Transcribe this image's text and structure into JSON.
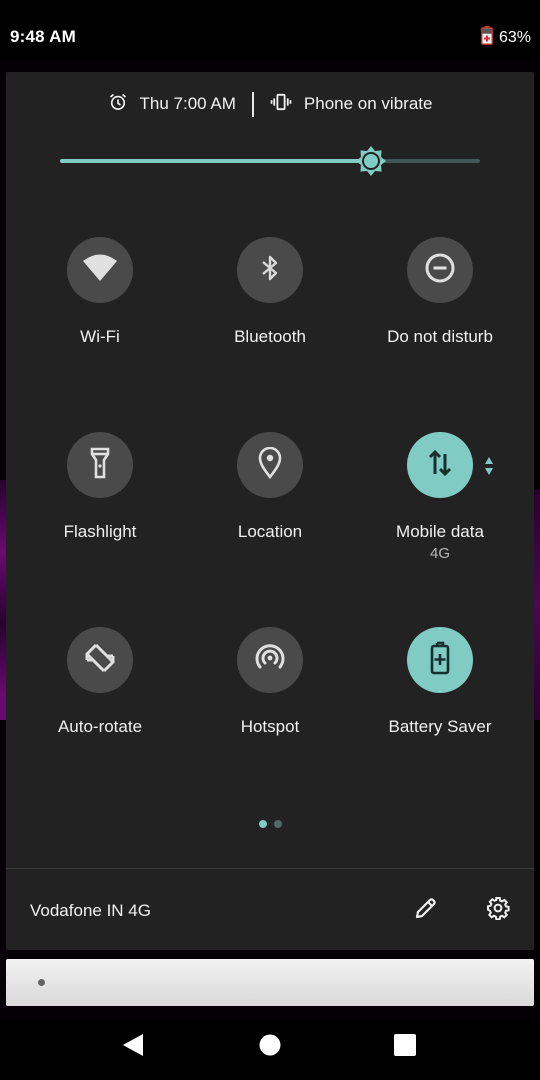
{
  "status_bar": {
    "time": "9:48 AM",
    "battery_icon": "battery-saver-charging-icon",
    "battery_percent": "63%"
  },
  "quick_settings": {
    "alarm": {
      "icon": "alarm-clock-icon",
      "text": "Thu 7:00 AM"
    },
    "ringer": {
      "icon": "vibrate-icon",
      "text": "Phone on vibrate"
    },
    "brightness": {
      "icon": "brightness-sun-icon",
      "level_fraction": 0.74
    },
    "tiles": [
      {
        "id": "wifi",
        "label": "Wi-Fi",
        "icon": "wifi-icon",
        "active": false
      },
      {
        "id": "bluetooth",
        "label": "Bluetooth",
        "icon": "bluetooth-icon",
        "active": false
      },
      {
        "id": "dnd",
        "label": "Do not disturb",
        "icon": "do-not-disturb-icon",
        "active": false
      },
      {
        "id": "flashlight",
        "label": "Flashlight",
        "icon": "flashlight-icon",
        "active": false
      },
      {
        "id": "location",
        "label": "Location",
        "icon": "location-pin-icon",
        "active": false
      },
      {
        "id": "mobile-data",
        "label": "Mobile data",
        "sublabel": "4G",
        "icon": "mobile-data-arrows-icon",
        "active": true,
        "expandable": true
      },
      {
        "id": "auto-rotate",
        "label": "Auto-rotate",
        "icon": "auto-rotate-icon",
        "active": false
      },
      {
        "id": "hotspot",
        "label": "Hotspot",
        "icon": "hotspot-icon",
        "active": false
      },
      {
        "id": "battery-saver",
        "label": "Battery Saver",
        "icon": "battery-saver-icon",
        "active": true
      }
    ],
    "pagination": {
      "pages": 2,
      "current": 1
    },
    "footer": {
      "carrier": "Vodafone IN 4G",
      "edit_icon": "pencil-icon",
      "settings_icon": "gear-icon"
    }
  },
  "notification": {
    "icon": "small-dot-icon"
  },
  "nav_bar": {
    "back_icon": "back-triangle-icon",
    "home_icon": "home-circle-icon",
    "recents_icon": "recents-square-icon"
  },
  "colors": {
    "accent": "#80cbc4",
    "panel_bg": "#222222",
    "tile_inactive": "#4a4a4a",
    "icon_on_active": "#1f3a38"
  }
}
